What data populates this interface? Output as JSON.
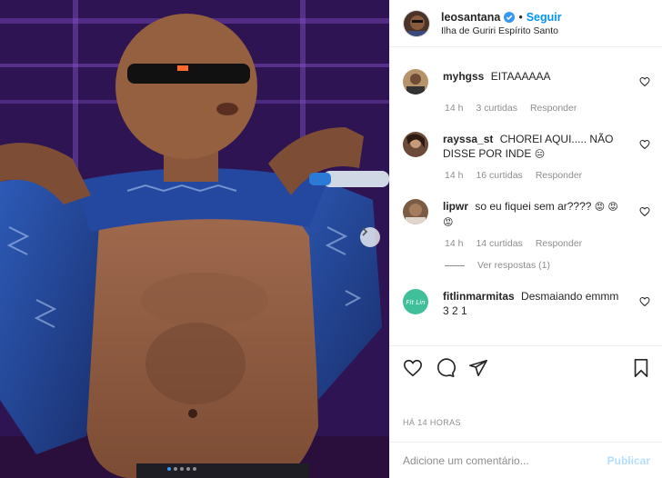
{
  "post": {
    "username": "leosantana",
    "follow_label": "Seguir",
    "separator": "•",
    "location": "Ilha de Guriri Espírito Santo"
  },
  "comments": [
    {
      "user": "myhgss",
      "text": "EITAAAAAA",
      "time": "14 h",
      "likes": "3 curtidas",
      "reply": "Responder",
      "avatar_color": "#b7936b"
    },
    {
      "user": "rayssa_st",
      "text": "CHOREI AQUI..... NÃO DISSE POR INDE",
      "emoji": "😑",
      "time": "14 h",
      "likes": "16 curtidas",
      "reply": "Responder",
      "avatar_color": "#6b4a3a"
    },
    {
      "user": "lipwr",
      "text": "so eu fiquei sem ar????",
      "emoji": "😡 😡 😡",
      "time": "14 h",
      "likes": "14 curtidas",
      "reply": "Responder",
      "view_replies": "Ver respostas (1)",
      "avatar_color": "#7a5c44"
    },
    {
      "user": "fitlinmarmitas",
      "text": "Desmaiando emmm 3 2 1",
      "avatar_color": "#3fbf9a",
      "avatar_text": "Fit Lin"
    }
  ],
  "footer": {
    "time_label": "HÁ 14 HORAS",
    "comment_placeholder": "Adicione um comentário...",
    "publish_label": "Publicar"
  },
  "icons": {
    "like": "heart-icon",
    "comment": "comment-icon",
    "share": "share-icon",
    "save": "bookmark-icon",
    "verified": "verified-badge-icon",
    "next": "chevron-right-icon"
  },
  "colors": {
    "link_blue": "#0095f6",
    "verified_blue": "#3897f0",
    "publish_disabled": "#b2dffc",
    "muted_gray": "#8e8e8e"
  }
}
